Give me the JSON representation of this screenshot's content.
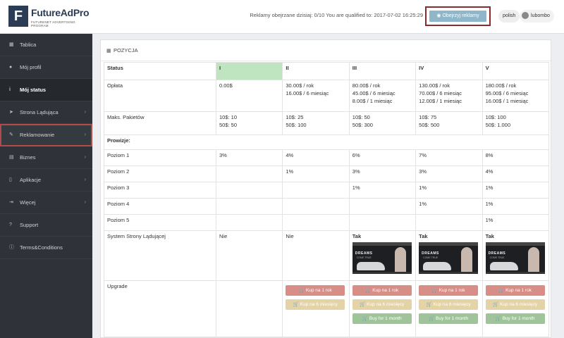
{
  "app": {
    "logo_mark": "F",
    "logo_text": "FutureAdPro",
    "logo_sub": "FUTURENET ADVERTISING PROGRAM"
  },
  "sidebar": {
    "items": [
      {
        "label": "Tablica",
        "icon": "dashboard-icon",
        "glyph": "▦",
        "chevron": false,
        "active": false
      },
      {
        "label": "Mój profil",
        "icon": "user-icon",
        "glyph": "●",
        "chevron": false,
        "active": false
      },
      {
        "label": "Mój status",
        "icon": "info-icon",
        "glyph": "i",
        "chevron": false,
        "active": true
      },
      {
        "label": "Strona Lądująca",
        "icon": "send-icon",
        "glyph": "➤",
        "chevron": true,
        "active": false
      },
      {
        "label": "Reklamowanie",
        "icon": "wand-icon",
        "glyph": "✎",
        "chevron": true,
        "active": false
      },
      {
        "label": "Biznes",
        "icon": "briefcase-icon",
        "glyph": "▤",
        "chevron": true,
        "active": false
      },
      {
        "label": "Aplikacje",
        "icon": "phone-icon",
        "glyph": "▯",
        "chevron": true,
        "active": false
      },
      {
        "label": "Więcej",
        "icon": "signin-icon",
        "glyph": "⇥",
        "chevron": true,
        "active": false
      },
      {
        "label": "Support",
        "icon": "help-icon",
        "glyph": "?",
        "chevron": false,
        "active": false
      },
      {
        "label": "Terms&Conditions",
        "icon": "info-circle-icon",
        "glyph": "ⓘ",
        "chevron": false,
        "active": false
      }
    ]
  },
  "topbar": {
    "ads_prefix": "Reklamy obejrzane dzisiaj:",
    "ads_value": "0/10",
    "qualified": "You are qualified to: 2017-07-02 16:25:29",
    "watch_button": "Obejrzyj reklamy",
    "language": "polish",
    "username": "lubombo"
  },
  "panel": {
    "title": "POZYCJA"
  },
  "table": {
    "headers": [
      "Status",
      "I",
      "II",
      "III",
      "IV",
      "V"
    ],
    "oplata": {
      "label": "Opłata",
      "cols": [
        [
          "0.00$"
        ],
        [
          "30.00$ / rok",
          "16.00$ / 6 miesiąc"
        ],
        [
          "80.00$ / rok",
          "45.00$ / 6 miesiąc",
          "8.00$ / 1 miesiąc"
        ],
        [
          "130.00$ / rok",
          "70.00$ / 6 miesiąc",
          "12.00$ / 1 miesiąc"
        ],
        [
          "180.00$ / rok",
          "95.00$ / 6 miesiąc",
          "16.00$ / 1 miesiąc"
        ]
      ]
    },
    "pakiety": {
      "label": "Maks. Pakietów",
      "cols": [
        [
          "10$: 10",
          "50$: 50"
        ],
        [
          "10$: 25",
          "50$: 100"
        ],
        [
          "10$: 50",
          "50$: 300"
        ],
        [
          "10$: 75",
          "50$: 500"
        ],
        [
          "10$: 100",
          "50$: 1.000"
        ]
      ]
    },
    "prowizje": {
      "label": "Prowizje:",
      "levels": [
        {
          "label": "Poziom 1",
          "cols": [
            "3%",
            "4%",
            "6%",
            "7%",
            "8%"
          ]
        },
        {
          "label": "Poziom 2",
          "cols": [
            "",
            "1%",
            "3%",
            "3%",
            "4%"
          ]
        },
        {
          "label": "Poziom 3",
          "cols": [
            "",
            "",
            "1%",
            "1%",
            "1%"
          ]
        },
        {
          "label": "Poziom 4",
          "cols": [
            "",
            "",
            "",
            "1%",
            "1%"
          ]
        },
        {
          "label": "Poziom 5",
          "cols": [
            "",
            "",
            "",
            "",
            "1%"
          ]
        }
      ]
    },
    "system": {
      "label": "System Strony Lądującej",
      "cols": [
        "Nie",
        "Nie",
        "Tak",
        "Tak",
        "Tak"
      ],
      "thumb_title": "DREAMS",
      "thumb_sub": "COME TRUE"
    },
    "upgrade": {
      "label": "Upgrade",
      "buy_year": "Kup na 1 rok",
      "buy_6m": "Kup na 6 miesięcy",
      "buy_1m": "Buy for 1 month"
    }
  }
}
